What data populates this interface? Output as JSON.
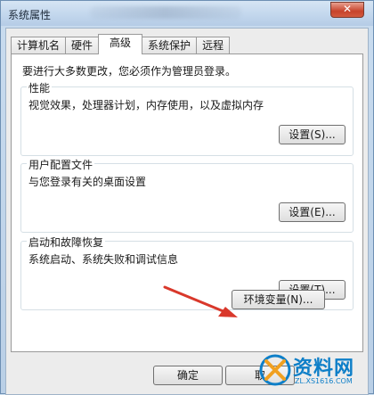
{
  "window": {
    "title": "系统属性",
    "close_symbol": "✕"
  },
  "tabs": [
    {
      "label": "计算机名",
      "active": false
    },
    {
      "label": "硬件",
      "active": false
    },
    {
      "label": "高级",
      "active": true
    },
    {
      "label": "系统保护",
      "active": false
    },
    {
      "label": "远程",
      "active": false
    }
  ],
  "notice": "要进行大多数更改，您必须作为管理员登录。",
  "groups": {
    "performance": {
      "title": "性能",
      "desc": "视觉效果，处理器计划，内存使用，以及虚拟内存",
      "button": "设置(S)..."
    },
    "user_profiles": {
      "title": "用户配置文件",
      "desc": "与您登录有关的桌面设置",
      "button": "设置(E)..."
    },
    "startup_recovery": {
      "title": "启动和故障恢复",
      "desc": "系统启动、系统失败和调试信息",
      "button": "设置(T)..."
    }
  },
  "env_button": "环境变量(N)...",
  "footer": {
    "ok": "确定",
    "cancel": "取"
  },
  "watermark": {
    "text": "资料网",
    "sub": "ZL.XS1616.COM"
  },
  "colors": {
    "arrow": "#d9382b",
    "close": "#c7432b",
    "watermark": "#0e7fc8"
  }
}
